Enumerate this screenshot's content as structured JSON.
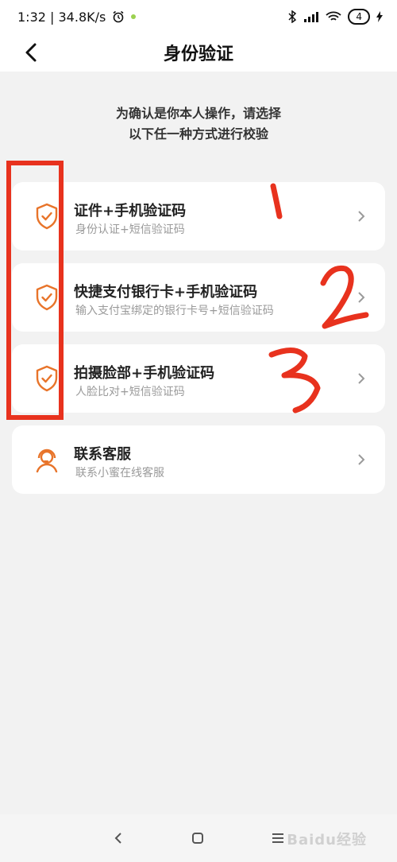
{
  "status_bar": {
    "time_speed": "1:32 | 34.8K/s",
    "battery": "4"
  },
  "header": {
    "title": "身份验证"
  },
  "instructions": {
    "line1": "为确认是你本人操作，请选择",
    "line2": "以下任一种方式进行校验"
  },
  "options": [
    {
      "title": "证件+手机验证码",
      "subtitle": "身份认证+短信验证码"
    },
    {
      "title": "快捷支付银行卡+手机验证码",
      "subtitle": "输入支付宝绑定的银行卡号+短信验证码"
    },
    {
      "title": "拍摄脸部+手机验证码",
      "subtitle": "人脸比对+短信验证码"
    }
  ],
  "support": {
    "title": "联系客服",
    "subtitle": "联系小蜜在线客服"
  },
  "annotations": [
    "1",
    "2",
    "3"
  ],
  "watermark": "Baidu经验",
  "colors": {
    "accent": "#e8742a",
    "annotation_red": "#e8321e"
  }
}
